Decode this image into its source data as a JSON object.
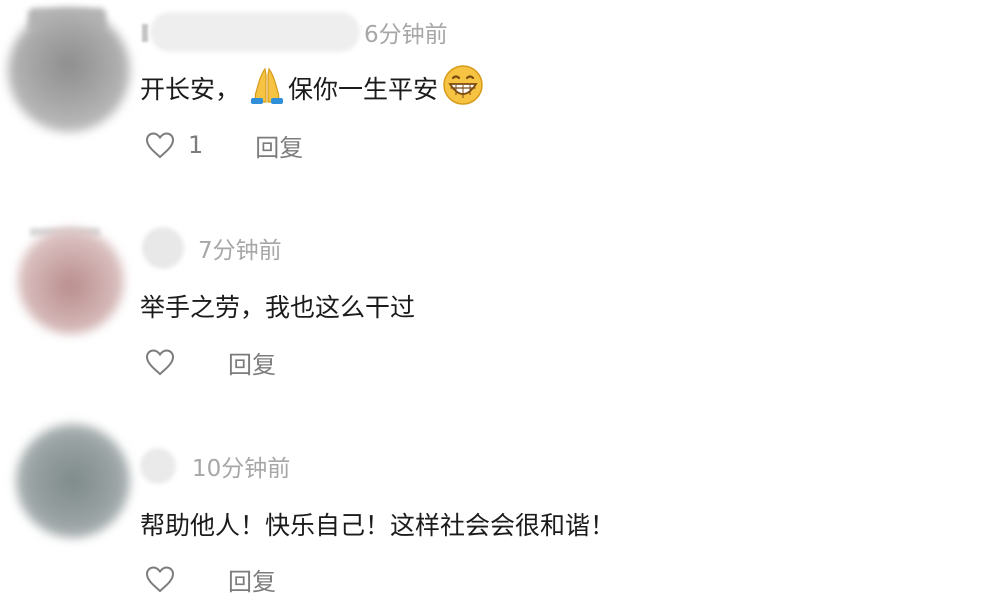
{
  "comments": [
    {
      "time": "6分钟前",
      "text_before_emoji": "开长安，",
      "emoji_inline_1": "folded-hands-icon",
      "text_middle": "保你一生平安",
      "emoji_inline_2": "grinning-face-icon",
      "likes": "1",
      "reply_label": "回复",
      "avatar_color": "#9a9a9a"
    },
    {
      "time": "7分钟前",
      "text": "举手之劳，我也这么干过",
      "reply_label": "回复",
      "avatar_color": "#c9a6a6"
    },
    {
      "time": "10分钟前",
      "text": "帮助他人！快乐自己！这样社会会很和谐！",
      "reply_label": "回复",
      "avatar_color": "#8c9596"
    }
  ],
  "colors": {
    "text": "#1b1b1b",
    "meta": "#a7a7a7",
    "action": "#7c7c7c",
    "emoji_yellow": "#f6c343"
  }
}
